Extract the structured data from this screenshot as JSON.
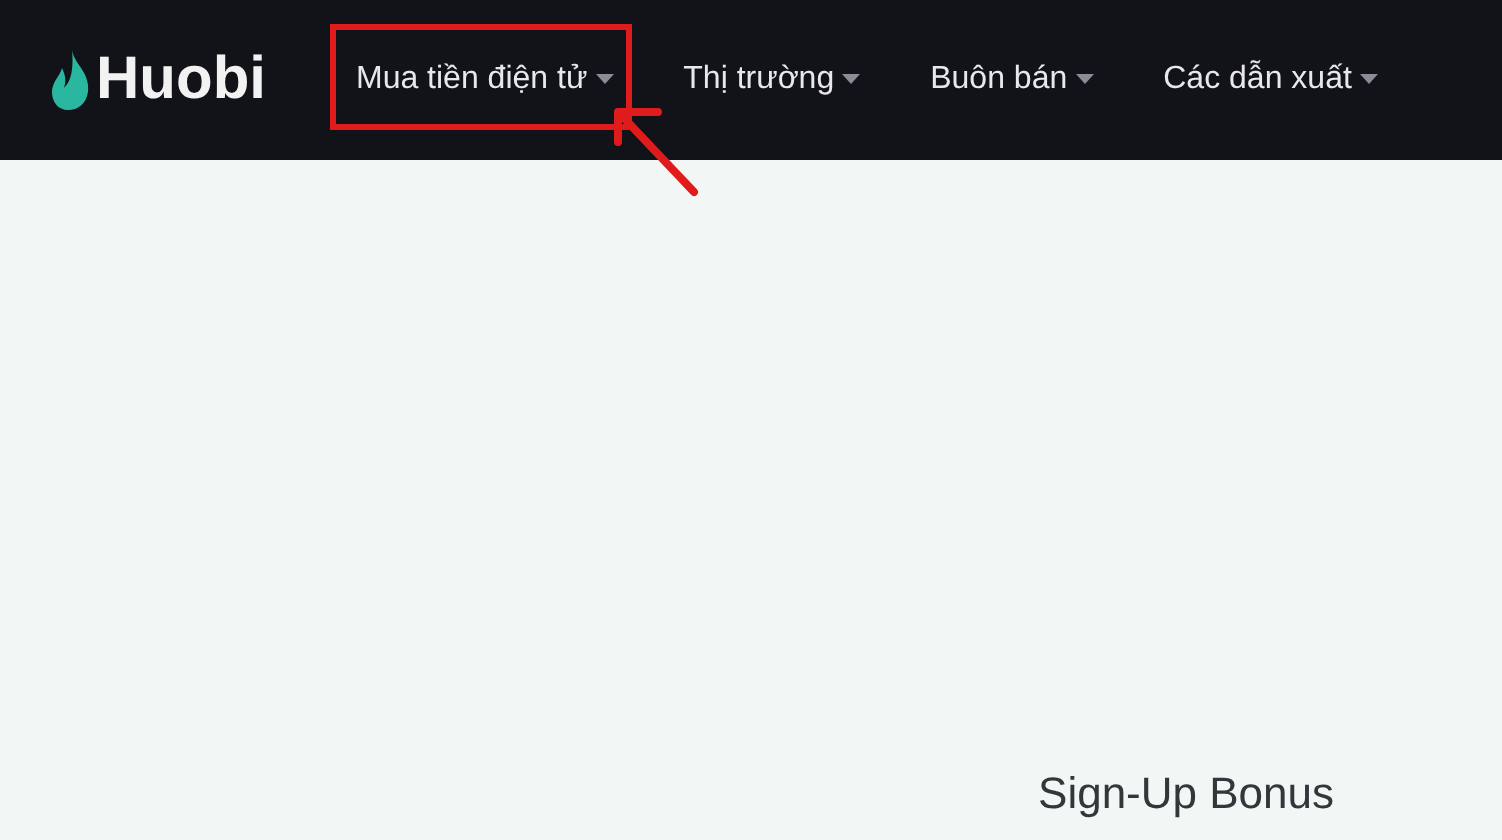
{
  "logo": {
    "text": "Huobi"
  },
  "nav": [
    {
      "label": "Mua tiền điện tử",
      "highlighted": true
    },
    {
      "label": "Thị trường",
      "highlighted": false
    },
    {
      "label": "Buôn bán",
      "highlighted": false
    },
    {
      "label": "Các dẫn xuất",
      "highlighted": false
    }
  ],
  "content": {
    "heading": "Sign-Up Bonus"
  }
}
